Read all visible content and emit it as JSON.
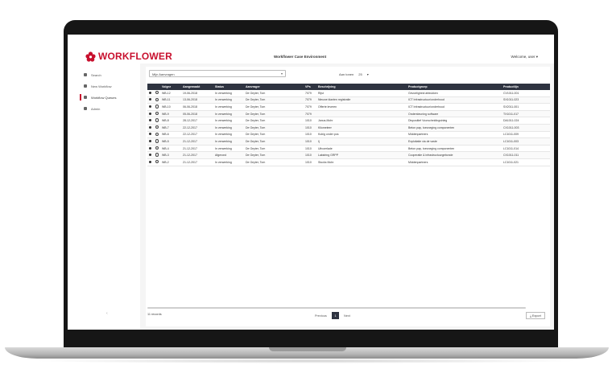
{
  "header": {
    "logo_text": "WORKFLOWER",
    "app_title": "Workflower Case Environment",
    "user": "Welcome, user"
  },
  "sidebar": {
    "items": [
      {
        "label": "Search",
        "icon": "search-icon"
      },
      {
        "label": "New Workflow",
        "icon": "plus-icon"
      },
      {
        "label": "Workflow Queues",
        "icon": "list-icon"
      },
      {
        "label": "Admin",
        "icon": "gear-icon"
      }
    ],
    "collapse_glyph": "‹"
  },
  "filters": {
    "select_value": "Mijn Aanvragen",
    "per_page_label": "Aan tonen",
    "per_page_value": "25"
  },
  "grid": {
    "columns": [
      "",
      "",
      "Volgnr",
      "Aangemaakt",
      "Status",
      "Aanvrager",
      "VPs",
      "Beschrijving",
      "Productgroep",
      "Productlijn"
    ],
    "rows": [
      [
        "",
        "",
        "WB-12",
        "19-06-2018",
        "In verwerking",
        "De Geyter, Tom",
        "7079",
        "Rijst",
        "Gevoeligheid afdrukken",
        "CV1011-001"
      ],
      [
        "",
        "",
        "WB-11",
        "13-06-2018",
        "In verwerking",
        "De Geyter, Tom",
        "7079",
        "Nieuwe klanten registratie",
        "ICT Infrastructuur/onderhoud",
        "SX1011-023"
      ],
      [
        "",
        "",
        "WB-10",
        "06-06-2018",
        "In verwerking",
        "De Geyter, Tom",
        "7079",
        "Offerte leveren",
        "ICT Infrastructuur/onderhoud",
        "SX2011-001"
      ],
      [
        "",
        "",
        "WB-9",
        "05-06-2018",
        "In verwerking",
        "De Geyter, Tom",
        "7079",
        "",
        "Ondersteuning software",
        "TX1011-017"
      ],
      [
        "",
        "",
        "WB-8",
        "28-12-2017",
        "In verwerking",
        "De Geyter, Tom",
        "1010",
        "Janus-Mohr",
        "Dispositief Voorscheidingsinleg",
        "DA1011-024"
      ],
      [
        "",
        "",
        "WB-7",
        "22-12-2017",
        "In verwerking",
        "De Geyter, Tom",
        "1010",
        "Kilometeer",
        "Beton pap, toevoeging componenten",
        "CX1011-003"
      ],
      [
        "",
        "",
        "WB-6",
        "22-12-2017",
        "In verwerking",
        "De Geyter, Tom",
        "1010",
        "Kubig onder pos",
        "Middenpartners",
        "LC1011-009"
      ],
      [
        "",
        "",
        "WB-5",
        "21-12-2017",
        "In verwerking",
        "De Geyter, Tom",
        "1010",
        "Ij",
        "Exploitatie via de vaste",
        "LC1011-003"
      ],
      [
        "",
        "",
        "WB-4",
        "21-12-2017",
        "In verwerking",
        "De Geyter, Tom",
        "1010",
        "Uitvoerlade",
        "Beton pap, toevoeging componenten",
        "LC1011-014"
      ],
      [
        "",
        "",
        "WB-3",
        "21-12-2017",
        "Afgerond",
        "De Geyter, Tom",
        "1010",
        "Lakstring GRPP",
        "Cooperatie & infrastructuurgebonde",
        "CX1011-011"
      ],
      [
        "",
        "",
        "WB-2",
        "21-12-2017",
        "In verwerking",
        "De Geyter, Tom",
        "1010",
        "Stocks Mohr",
        "Middenpartners",
        "LC1011-021"
      ]
    ]
  },
  "footer": {
    "count": "11 records",
    "prev_label": "Previous",
    "current_page": "1",
    "next_label": "Next",
    "export_label": "Export"
  },
  "colors": {
    "brand": "#c8102e",
    "grid_header": "#2e3340"
  }
}
